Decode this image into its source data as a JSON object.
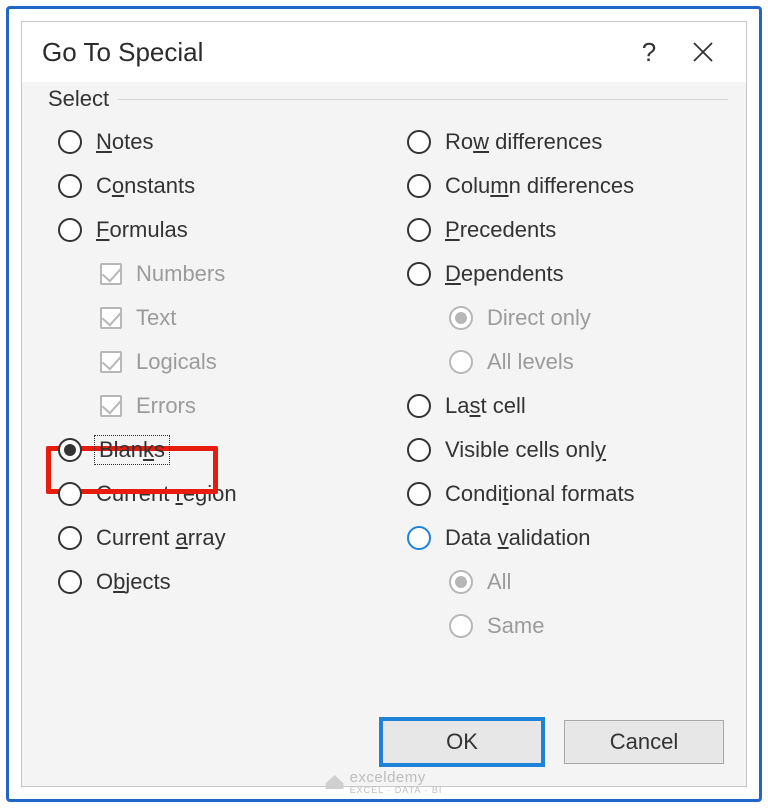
{
  "dialog": {
    "title": "Go To Special",
    "help_symbol": "?",
    "group_label": "Select"
  },
  "left": {
    "notes": {
      "pre": "",
      "ul": "N",
      "post": "otes"
    },
    "constants": {
      "pre": "C",
      "ul": "o",
      "post": "nstants"
    },
    "formulas": {
      "pre": "",
      "ul": "F",
      "post": "ormulas"
    },
    "chk_numbers": "Numbers",
    "chk_text": "Text",
    "chk_logicals": "Logicals",
    "chk_errors": "Errors",
    "blanks": {
      "pre": "Blan",
      "ul": "k",
      "post": "s"
    },
    "cur_region": {
      "pre": "Current ",
      "ul": "r",
      "post": "egion"
    },
    "cur_array": {
      "pre": "Current ",
      "ul": "a",
      "post": "rray"
    },
    "objects": {
      "pre": "O",
      "ul": "b",
      "post": "jects"
    }
  },
  "right": {
    "row_diff": {
      "pre": "Ro",
      "ul": "w",
      "post": " differences"
    },
    "col_diff": {
      "pre": "Colu",
      "ul": "m",
      "post": "n differences"
    },
    "precedents": {
      "pre": "",
      "ul": "P",
      "post": "recedents"
    },
    "dependents": {
      "pre": "",
      "ul": "D",
      "post": "ependents"
    },
    "direct_only": "Direct only",
    "all_levels": "All levels",
    "last_cell": {
      "pre": "La",
      "ul": "s",
      "post": "t cell"
    },
    "visible": {
      "pre": "Visible cells onl",
      "ul": "y",
      "post": ""
    },
    "cond_fmt": {
      "pre": "Condi",
      "ul": "t",
      "post": "ional formats"
    },
    "data_val": {
      "pre": "Data ",
      "ul": "v",
      "post": "alidation"
    },
    "dv_all": "All",
    "dv_same": "Same"
  },
  "buttons": {
    "ok": "OK",
    "cancel": "Cancel"
  },
  "watermark": {
    "main": "exceldemy",
    "sub": "EXCEL · DATA · BI"
  }
}
